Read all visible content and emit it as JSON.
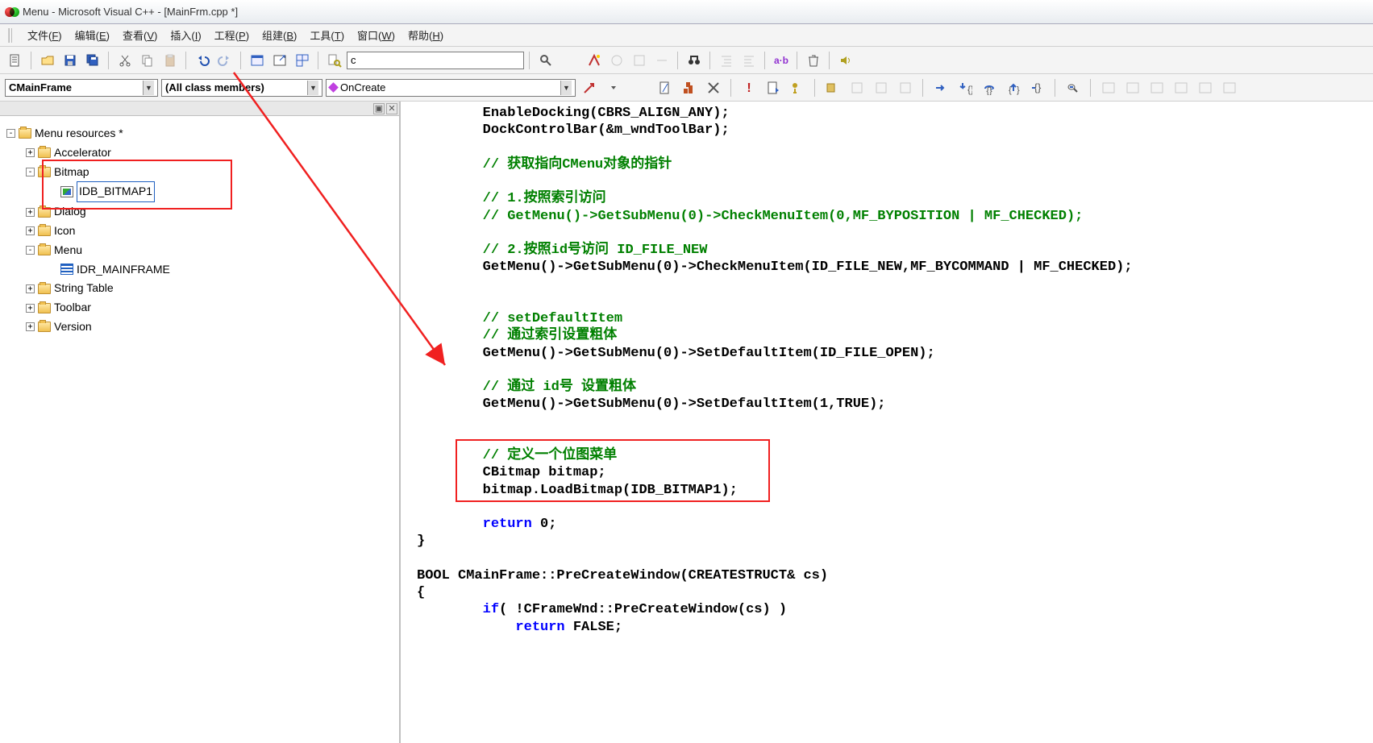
{
  "title": "Menu - Microsoft Visual C++ - [MainFrm.cpp *]",
  "menubar": {
    "items": [
      {
        "label": "文件",
        "key": "F"
      },
      {
        "label": "编辑",
        "key": "E"
      },
      {
        "label": "查看",
        "key": "V"
      },
      {
        "label": "插入",
        "key": "I"
      },
      {
        "label": "工程",
        "key": "P"
      },
      {
        "label": "组建",
        "key": "B"
      },
      {
        "label": "工具",
        "key": "T"
      },
      {
        "label": "窗口",
        "key": "W"
      },
      {
        "label": "帮助",
        "key": "H"
      }
    ]
  },
  "toolbar": {
    "find_value": "c",
    "replace_label": "a·b"
  },
  "classbar": {
    "class_combo": "CMainFrame",
    "filter_combo": "(All class members)",
    "member_combo": "OnCreate"
  },
  "tree": {
    "root": "Menu resources *",
    "items": [
      {
        "label": "Accelerator",
        "exp": "+"
      },
      {
        "label": "Bitmap",
        "exp": "-",
        "children": [
          {
            "label": "IDB_BITMAP1",
            "icon": "bmp",
            "selected": true
          }
        ]
      },
      {
        "label": "Dialog",
        "exp": "+"
      },
      {
        "label": "Icon",
        "exp": "+"
      },
      {
        "label": "Menu",
        "exp": "-",
        "children": [
          {
            "label": "IDR_MAINFRAME",
            "icon": "menu"
          }
        ]
      },
      {
        "label": "String Table",
        "exp": "+"
      },
      {
        "label": "Toolbar",
        "exp": "+"
      },
      {
        "label": "Version",
        "exp": "+"
      }
    ]
  },
  "code": {
    "lines": [
      {
        "indent": 2,
        "segs": [
          {
            "t": "EnableDocking(CBRS_ALIGN_ANY);"
          }
        ]
      },
      {
        "indent": 2,
        "segs": [
          {
            "t": "DockControlBar(&m_wndToolBar);"
          }
        ]
      },
      {
        "indent": 2,
        "segs": []
      },
      {
        "indent": 2,
        "segs": [
          {
            "c": "cm",
            "t": "// 获取指向CMenu对象的指针"
          }
        ]
      },
      {
        "indent": 2,
        "segs": []
      },
      {
        "indent": 2,
        "segs": [
          {
            "c": "cm",
            "t": "// 1.按照索引访问"
          }
        ]
      },
      {
        "indent": 2,
        "segs": [
          {
            "c": "cm",
            "t": "// GetMenu()->GetSubMenu(0)->CheckMenuItem(0,MF_BYPOSITION | MF_CHECKED);"
          }
        ]
      },
      {
        "indent": 2,
        "segs": []
      },
      {
        "indent": 2,
        "segs": [
          {
            "c": "cm",
            "t": "// 2.按照id号访问 ID_FILE_NEW"
          }
        ]
      },
      {
        "indent": 2,
        "segs": [
          {
            "t": "GetMenu()->GetSubMenu(0)->CheckMenuItem(ID_FILE_NEW,MF_BYCOMMAND | MF_CHECKED);"
          }
        ]
      },
      {
        "indent": 2,
        "segs": []
      },
      {
        "indent": 2,
        "segs": []
      },
      {
        "indent": 2,
        "segs": [
          {
            "c": "cm",
            "t": "// setDefaultItem"
          }
        ]
      },
      {
        "indent": 2,
        "segs": [
          {
            "c": "cm",
            "t": "// 通过索引设置粗体"
          }
        ]
      },
      {
        "indent": 2,
        "segs": [
          {
            "t": "GetMenu()->GetSubMenu(0)->SetDefaultItem(ID_FILE_OPEN);"
          }
        ]
      },
      {
        "indent": 2,
        "segs": []
      },
      {
        "indent": 2,
        "segs": [
          {
            "c": "cm",
            "t": "// 通过 id号 设置粗体"
          }
        ]
      },
      {
        "indent": 2,
        "segs": [
          {
            "t": "GetMenu()->GetSubMenu(0)->SetDefaultItem(1,TRUE);"
          }
        ]
      },
      {
        "indent": 2,
        "segs": []
      },
      {
        "indent": 2,
        "segs": []
      },
      {
        "indent": 2,
        "segs": [
          {
            "c": "cm",
            "t": "// 定义一个位图菜单"
          }
        ]
      },
      {
        "indent": 2,
        "segs": [
          {
            "t": "CBitmap bitmap;"
          }
        ]
      },
      {
        "indent": 2,
        "segs": [
          {
            "t": "bitmap.LoadBitmap(IDB_BITMAP1);"
          }
        ]
      },
      {
        "indent": 2,
        "segs": []
      },
      {
        "indent": 2,
        "segs": [
          {
            "c": "kw",
            "t": "return"
          },
          {
            "t": " 0;"
          }
        ]
      },
      {
        "indent": 0,
        "segs": [
          {
            "t": "}"
          }
        ]
      },
      {
        "indent": 0,
        "segs": []
      },
      {
        "indent": 0,
        "segs": [
          {
            "t": "BOOL CMainFrame::PreCreateWindow(CREATESTRUCT& cs)"
          }
        ]
      },
      {
        "indent": 0,
        "segs": [
          {
            "t": "{"
          }
        ]
      },
      {
        "indent": 2,
        "segs": [
          {
            "c": "kw",
            "t": "if"
          },
          {
            "t": "( !CFrameWnd::PreCreateWindow(cs) )"
          }
        ]
      },
      {
        "indent": 3,
        "segs": [
          {
            "c": "kw",
            "t": "return"
          },
          {
            "t": " FALSE;"
          }
        ]
      }
    ]
  }
}
